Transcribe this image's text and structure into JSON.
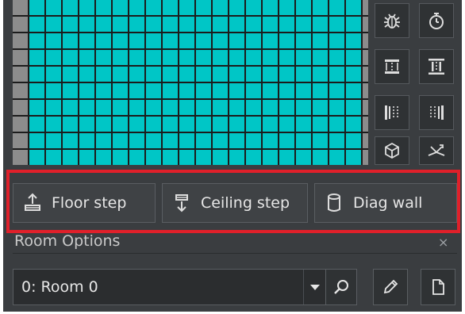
{
  "step_buttons": {
    "floor_step": "Floor step",
    "ceiling_step": "Ceiling step",
    "diag_wall": "Diag wall"
  },
  "room_options": {
    "title": "Room Options",
    "close_glyph": "×",
    "selected_room": "0: Room 0"
  },
  "icons": {
    "tools": [
      "bug-icon",
      "timer-icon",
      "pillar-top-icon",
      "pillar-dots-icon",
      "pillar-left-icon",
      "pillar-right-icon",
      "box-3d-icon",
      "split-flip-icon"
    ],
    "room_actions": [
      "search-icon",
      "pencil-icon",
      "new-file-icon"
    ]
  },
  "colors": {
    "grid_fill": "#00c6c6",
    "grid_line": "#0f1b1b",
    "border_cell": "#8c8c8c",
    "highlight": "#e0202a",
    "panel_bg": "#3a3d40"
  }
}
